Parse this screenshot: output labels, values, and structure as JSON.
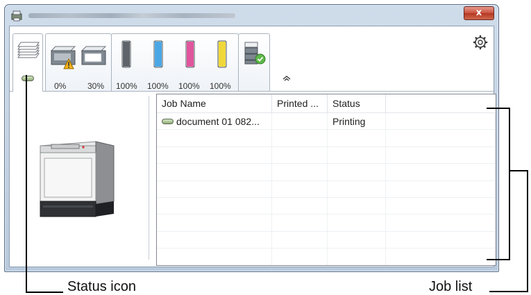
{
  "window": {
    "close_glyph": "x"
  },
  "toolbar": {
    "tabs": [
      {
        "name": "status-icon-tab",
        "icon": "printer-status-icon"
      },
      {
        "name": "paper-tray-tab",
        "icon": "paper-tray-icon"
      },
      {
        "name": "toner-tab",
        "icon": "toner-cartridge-icon"
      },
      {
        "name": "options-tab",
        "icon": "multifunction-ok-icon"
      }
    ],
    "tray_levels": [
      "0%",
      "30%"
    ],
    "toner_levels": [
      "100%",
      "100%",
      "100%",
      "100%"
    ],
    "toner_colors": [
      "#5e6469",
      "#4aa7e6",
      "#e0559c",
      "#f0d83a"
    ],
    "warning_color": "#f5b31a"
  },
  "joblist": {
    "columns": [
      "Job Name",
      "Printed ...",
      "Status"
    ],
    "rows": [
      {
        "job_name": "document 01 082...",
        "printed": "",
        "status": "Printing"
      }
    ]
  },
  "callouts": {
    "status_icon": "Status icon",
    "job_list": "Job list"
  }
}
